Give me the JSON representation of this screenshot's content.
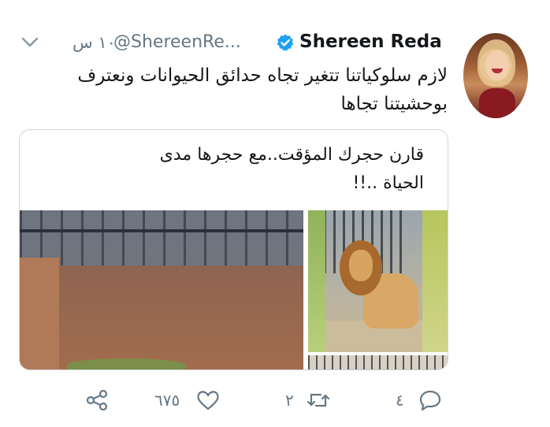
{
  "tweet": {
    "author_name": "Shereen Reda",
    "handle": "@ShereenRe...",
    "time": "١٠ س",
    "text_line1": "لازم سلوكياتنا تتغير تجاه حدائق الحيوانات ونعترف",
    "text_line2": "بوحشيتنا تجاها",
    "card_caption_line1": "قارن حجرك المؤقت..مع حجرها مدى",
    "card_caption_line2": "الحياة ..!!"
  },
  "actions": {
    "reply_count": "٤",
    "retweet_count": "٢",
    "like_count": "٦٧٥"
  },
  "colors": {
    "verified": "#1da1f2",
    "icon_gray": "#657786"
  }
}
